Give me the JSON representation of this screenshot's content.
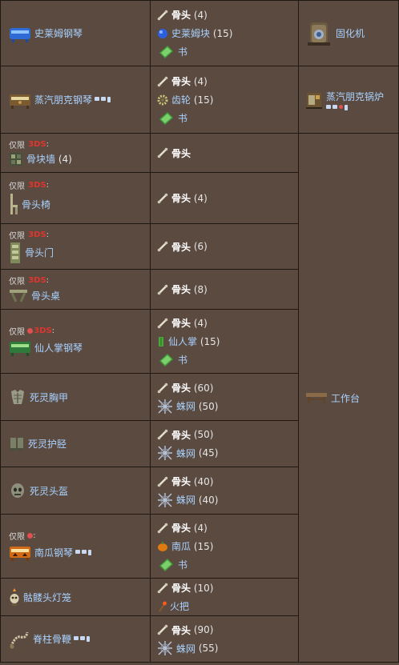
{
  "exclusive_label": "仅限",
  "three_ds": "3DS",
  "colon": ":",
  "rows": [
    {
      "name": "史莱姆钢琴",
      "ing": [
        {
          "n": "骨头",
          "q": "(4)",
          "bold": true
        },
        {
          "n": "史莱姆块",
          "q": "(15)"
        },
        {
          "n": "书",
          "q": ""
        }
      ]
    },
    {
      "name": "蒸汽朋克钢琴",
      "ing": [
        {
          "n": "骨头",
          "q": "(4)",
          "bold": true
        },
        {
          "n": "齿轮",
          "q": "(15)"
        },
        {
          "n": "书",
          "q": ""
        }
      ]
    },
    {
      "name": "骨块墙",
      "qty": "(4)",
      "ing": [
        {
          "n": "骨头",
          "q": "",
          "bold": true
        }
      ]
    },
    {
      "name": "骨头椅",
      "ing": [
        {
          "n": "骨头",
          "q": "(4)",
          "bold": true
        }
      ]
    },
    {
      "name": "骨头门",
      "ing": [
        {
          "n": "骨头",
          "q": "(6)",
          "bold": true
        }
      ]
    },
    {
      "name": "骨头桌",
      "ing": [
        {
          "n": "骨头",
          "q": "(8)",
          "bold": true
        }
      ]
    },
    {
      "name": "仙人掌钢琴",
      "ing": [
        {
          "n": "骨头",
          "q": "(4)",
          "bold": true
        },
        {
          "n": "仙人掌",
          "q": "(15)"
        },
        {
          "n": "书",
          "q": ""
        }
      ]
    },
    {
      "name": "死灵胸甲",
      "ing": [
        {
          "n": "骨头",
          "q": "(60)",
          "bold": true
        },
        {
          "n": "蛛网",
          "q": "(50)"
        }
      ]
    },
    {
      "name": "死灵护胫",
      "ing": [
        {
          "n": "骨头",
          "q": "(50)",
          "bold": true
        },
        {
          "n": "蛛网",
          "q": "(45)"
        }
      ]
    },
    {
      "name": "死灵头盔",
      "ing": [
        {
          "n": "骨头",
          "q": "(40)",
          "bold": true
        },
        {
          "n": "蛛网",
          "q": "(40)"
        }
      ]
    },
    {
      "name": "南瓜钢琴",
      "ing": [
        {
          "n": "骨头",
          "q": "(4)",
          "bold": true
        },
        {
          "n": "南瓜",
          "q": "(15)"
        },
        {
          "n": "书",
          "q": ""
        }
      ]
    },
    {
      "name": "骷髅头灯笼",
      "ing": [
        {
          "n": "骨头",
          "q": "(10)",
          "bold": true
        },
        {
          "n": "火把",
          "q": ""
        }
      ]
    },
    {
      "name": "脊柱骨鞭",
      "ing": [
        {
          "n": "骨头",
          "q": "(90)",
          "bold": true
        },
        {
          "n": "蛛网",
          "q": "(55)"
        }
      ]
    }
  ],
  "stations": {
    "solidifier": "固化机",
    "steampunk_boiler": "蒸汽朋克锅炉",
    "workbench": "工作台"
  }
}
